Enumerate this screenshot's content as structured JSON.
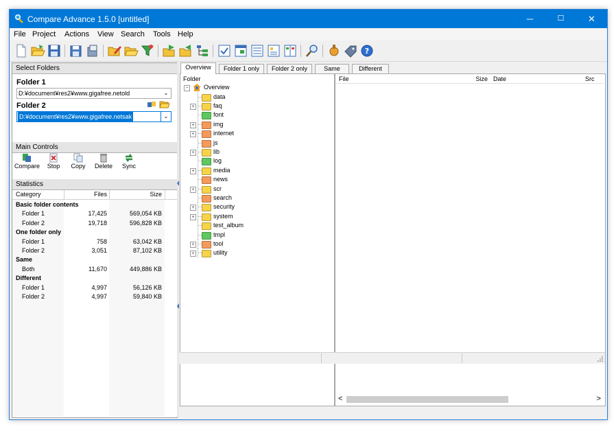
{
  "window": {
    "title": "Compare Advance 1.5.0 [untitled]"
  },
  "window_controls": {
    "minimize": "─",
    "maximize": "☐",
    "close": "✕"
  },
  "menu": [
    "File",
    "Project",
    "Actions",
    "View",
    "Search",
    "Tools",
    "Help"
  ],
  "toolbar_icons": [
    "new-icon",
    "open-icon",
    "save-icon",
    "save-as-icon",
    "load-icon",
    "edit-project-icon",
    "open-folder-icon",
    "filter-icon",
    "copy-left-icon",
    "copy-right-icon",
    "tree-icon",
    "check-icon",
    "window-icon",
    "list-icon",
    "detail-icon",
    "columns-icon",
    "search-icon",
    "tools-icon",
    "tag-icon",
    "help-icon"
  ],
  "select_folders": {
    "header": "Select Folders",
    "folder1_label": "Folder 1",
    "folder1_value": "D:¥document¥res2¥www.gigafree.netold",
    "folder2_label": "Folder 2",
    "folder2_value": "D:¥document¥res2¥www.gigafree.netsak"
  },
  "main_controls": {
    "header": "Main Controls",
    "buttons": [
      "Compare",
      "Stop",
      "Copy",
      "Delete",
      "Sync"
    ]
  },
  "statistics": {
    "header": "Statistics",
    "columns": [
      "Category",
      "Files",
      "Size"
    ],
    "rows": [
      {
        "category": "Basic folder contents",
        "files": "",
        "size": "",
        "group": true
      },
      {
        "category": "Folder 1",
        "files": "17,425",
        "size": "569,054 KB",
        "group": false
      },
      {
        "category": "Folder 2",
        "files": "19,718",
        "size": "596,828 KB",
        "group": false
      },
      {
        "category": "One folder only",
        "files": "",
        "size": "",
        "group": true
      },
      {
        "category": "Folder 1",
        "files": "758",
        "size": "63,042 KB",
        "group": false
      },
      {
        "category": "Folder 2",
        "files": "3,051",
        "size": "87,102 KB",
        "group": false
      },
      {
        "category": "Same",
        "files": "",
        "size": "",
        "group": true
      },
      {
        "category": "Both",
        "files": "11,670",
        "size": "449,886 KB",
        "group": false
      },
      {
        "category": "Different",
        "files": "",
        "size": "",
        "group": true
      },
      {
        "category": "Folder 1",
        "files": "4,997",
        "size": "56,126 KB",
        "group": false
      },
      {
        "category": "Folder 2",
        "files": "4,997",
        "size": "59,840 KB",
        "group": false
      }
    ]
  },
  "tabs": [
    "Overview",
    "Folder 1 only",
    "Folder 2 only",
    "Same",
    "Different"
  ],
  "tree": {
    "header": "Folder",
    "root": "Overview",
    "items": [
      {
        "name": "data",
        "expandable": false,
        "color": "#f7d34a"
      },
      {
        "name": "faq",
        "expandable": true,
        "color": "#f7d34a"
      },
      {
        "name": "font",
        "expandable": false,
        "color": "#5ec85e"
      },
      {
        "name": "img",
        "expandable": true,
        "color": "#f59a5a"
      },
      {
        "name": "internet",
        "expandable": true,
        "color": "#f59a5a"
      },
      {
        "name": "js",
        "expandable": false,
        "color": "#f59a5a"
      },
      {
        "name": "lib",
        "expandable": true,
        "color": "#f7d34a"
      },
      {
        "name": "log",
        "expandable": false,
        "color": "#5ec85e"
      },
      {
        "name": "media",
        "expandable": true,
        "color": "#f7d34a"
      },
      {
        "name": "news",
        "expandable": false,
        "color": "#f59a5a"
      },
      {
        "name": "scr",
        "expandable": true,
        "color": "#f7d34a"
      },
      {
        "name": "search",
        "expandable": false,
        "color": "#f59a5a"
      },
      {
        "name": "security",
        "expandable": true,
        "color": "#f7d34a"
      },
      {
        "name": "system",
        "expandable": true,
        "color": "#f7d34a"
      },
      {
        "name": "test_album",
        "expandable": false,
        "color": "#f7d34a"
      },
      {
        "name": "tmpl",
        "expandable": false,
        "color": "#5ec85e"
      },
      {
        "name": "tool",
        "expandable": true,
        "color": "#f59a5a"
      },
      {
        "name": "utility",
        "expandable": true,
        "color": "#f7d34a"
      }
    ]
  },
  "file_list": {
    "columns": [
      "File",
      "Size",
      "Date",
      "Src"
    ]
  },
  "scroll": {
    "left": "<",
    "right": ">"
  }
}
